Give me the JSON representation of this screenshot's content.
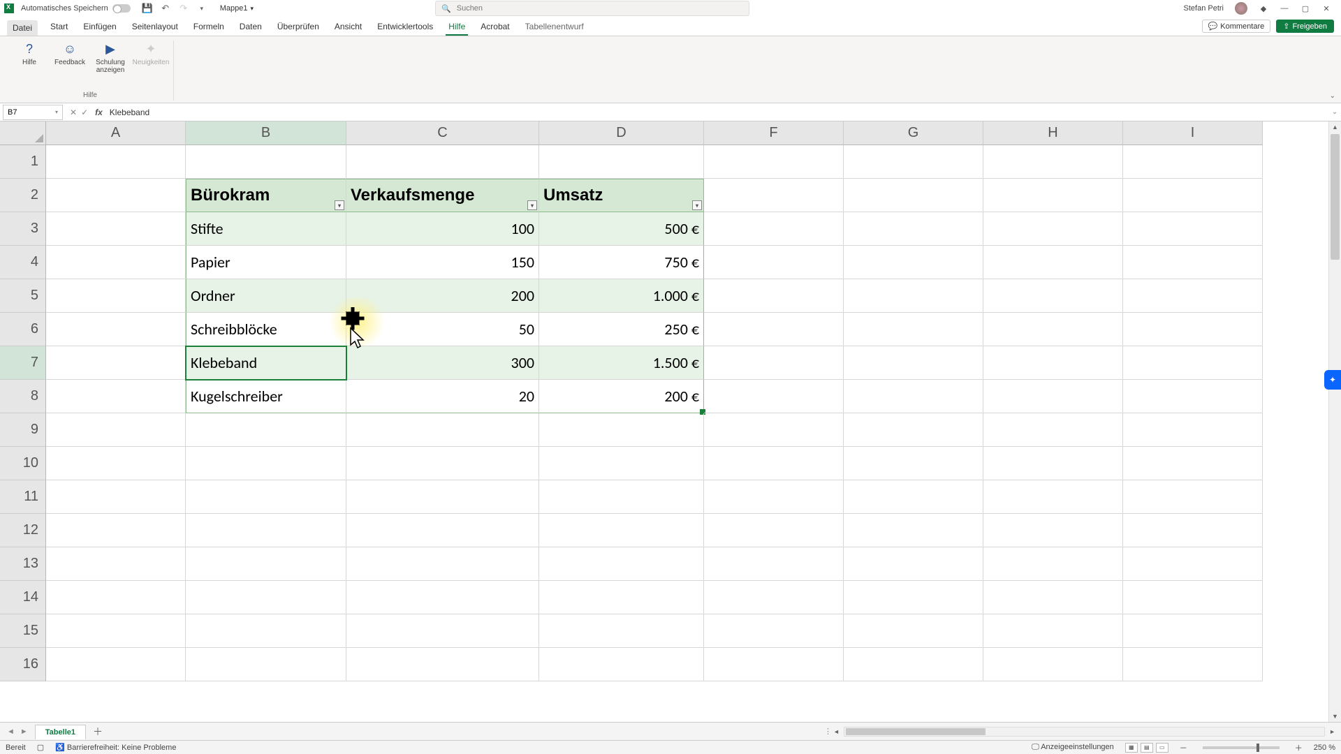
{
  "titlebar": {
    "autosave_label": "Automatisches Speichern",
    "doc_name": "Mappe1",
    "search_placeholder": "Suchen",
    "user_name": "Stefan Petri"
  },
  "ribbon": {
    "tabs": {
      "file": "Datei",
      "start": "Start",
      "insert": "Einfügen",
      "pagelayout": "Seitenlayout",
      "formulas": "Formeln",
      "data": "Daten",
      "review": "Überprüfen",
      "view": "Ansicht",
      "devtools": "Entwicklertools",
      "help": "Hilfe",
      "acrobat": "Acrobat",
      "tabledesign": "Tabellenentwurf"
    },
    "right": {
      "comments": "Kommentare",
      "share": "Freigeben"
    },
    "help_group": {
      "help": "Hilfe",
      "feedback": "Feedback",
      "training": "Schulung anzeigen",
      "news": "Neuigkeiten",
      "group_label": "Hilfe"
    }
  },
  "formula_bar": {
    "name_box": "B7",
    "formula": "Klebeband"
  },
  "columns": [
    "A",
    "B",
    "C",
    "D",
    "F",
    "G",
    "H",
    "I"
  ],
  "rows": [
    "1",
    "2",
    "3",
    "4",
    "5",
    "6",
    "7",
    "8",
    "9",
    "10",
    "11",
    "12",
    "13",
    "14",
    "15",
    "16"
  ],
  "table": {
    "headers": {
      "b": "Bürokram",
      "c": "Verkaufsmenge",
      "d": "Umsatz"
    },
    "rows": [
      {
        "b": "Stifte",
        "c": "100",
        "d": "500 €"
      },
      {
        "b": "Papier",
        "c": "150",
        "d": "750 €"
      },
      {
        "b": "Ordner",
        "c": "200",
        "d": "1.000 €"
      },
      {
        "b": "Schreibblöcke",
        "c": "50",
        "d": "250 €"
      },
      {
        "b": "Klebeband",
        "c": "300",
        "d": "1.500 €"
      },
      {
        "b": "Kugelschreiber",
        "c": "20",
        "d": "200 €"
      }
    ]
  },
  "sheet_tabs": {
    "sheet1": "Tabelle1"
  },
  "statusbar": {
    "ready": "Bereit",
    "accessibility": "Barrierefreiheit: Keine Probleme",
    "display_settings": "Anzeigeeinstellungen",
    "zoom": "250 %"
  }
}
